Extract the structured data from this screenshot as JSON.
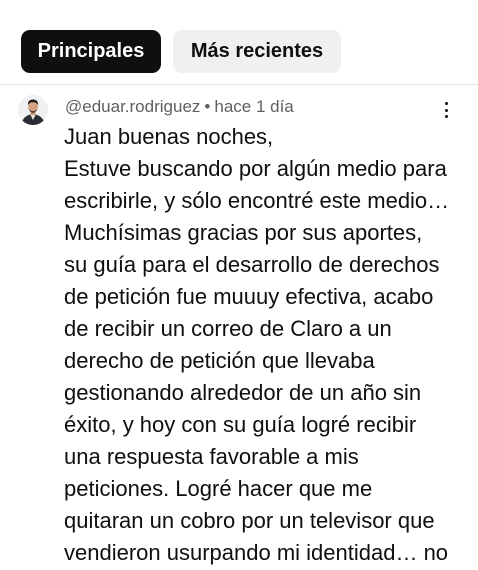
{
  "tabs": {
    "principales": "Principales",
    "recientes": "Más recientes"
  },
  "comment": {
    "author": "@eduar.rodriguez",
    "separator": "•",
    "time": "hace 1 día",
    "lines": [
      "Juan buenas noches,",
      "Estuve buscando por algún medio para",
      "escribirle, y sólo encontré este medio…",
      "Muchísimas gracias por sus aportes,",
      "su guía para el desarrollo de derechos",
      "de petición fue muuuy efectiva, acabo",
      "de recibir un correo de Claro a un",
      "derecho de petición que llevaba",
      "gestionando alrededor de un año sin",
      "éxito, y hoy con su guía logré recibir",
      "una respuesta favorable a mis",
      "peticiones. Logré hacer que me",
      "quitaran un cobro por un televisor que",
      "vendieron usurpando mi identidad… no"
    ]
  },
  "icons": {
    "more": "more-vertical-icon",
    "avatar": "user-avatar"
  },
  "colors": {
    "active_chip_bg": "#0f0f0f",
    "inactive_chip_bg": "#f0f0f0",
    "meta_text": "#606060",
    "body_text": "#0f0f0f"
  }
}
